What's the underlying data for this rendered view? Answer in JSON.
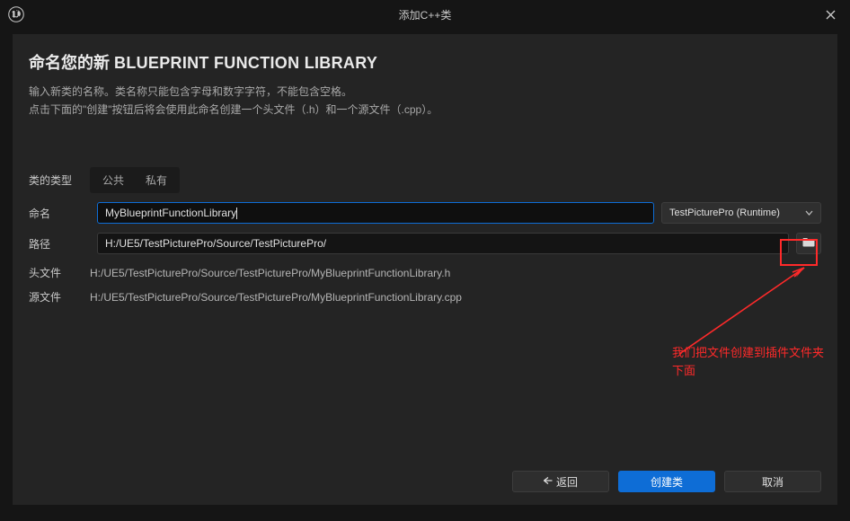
{
  "window": {
    "title": "添加C++类"
  },
  "header": {
    "prefix": "命名您的新",
    "className": "BLUEPRINT FUNCTION LIBRARY"
  },
  "description": {
    "line1": "输入新类的名称。类名称只能包含字母和数字字符，不能包含空格。",
    "line2": "点击下面的\"创建\"按钮后将会使用此命名创建一个头文件（.h）和一个源文件（.cpp）。"
  },
  "form": {
    "classTypeLabel": "类的类型",
    "classTypePublic": "公共",
    "classTypePrivate": "私有",
    "nameLabel": "命名",
    "nameValue": "MyBlueprintFunctionLibrary",
    "moduleValue": "TestPicturePro (Runtime)",
    "pathLabel": "路径",
    "pathValue": "H:/UE5/TestPicturePro/Source/TestPicturePro/",
    "headerLabel": "头文件",
    "headerValue": "H:/UE5/TestPicturePro/Source/TestPicturePro/MyBlueprintFunctionLibrary.h",
    "sourceLabel": "源文件",
    "sourceValue": "H:/UE5/TestPicturePro/Source/TestPicturePro/MyBlueprintFunctionLibrary.cpp"
  },
  "annotation": {
    "text": "我们把文件创建到插件文件夹下面"
  },
  "footer": {
    "back": "返回",
    "create": "创建类",
    "cancel": "取消"
  }
}
